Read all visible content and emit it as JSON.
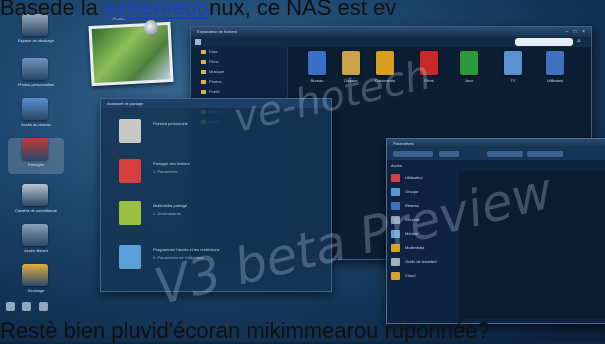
{
  "overlay": {
    "top_segments": [
      "Basede la ",
      "sysiemeoo",
      "nux, ce NAS est ev"
    ],
    "bottom_text": "Restè bien pluvid'écoran mikimmearou ruponnée?"
  },
  "watermark": {
    "line1": "ve-hotech",
    "line2": "V3 beta Preview"
  },
  "dock": {
    "items": [
      {
        "label": "Espace de stockage",
        "color": "#9aa8b8"
      },
      {
        "label": "Photos personnelles",
        "color": "#6f93c0"
      },
      {
        "label": "Accès au réseau",
        "color": "#5a8ed0"
      },
      {
        "label": "Partages",
        "color": "#c8383a"
      },
      {
        "label": "Caméra de surveillance",
        "color": "#b8c4d0"
      },
      {
        "label": "Accès distant",
        "color": "#8ca0b8"
      },
      {
        "label": "Stockage",
        "color": "#e0b040"
      }
    ],
    "tray": [
      "shield-icon",
      "globe-icon",
      "mail-icon"
    ]
  },
  "photo_widget": {
    "title": "Photos"
  },
  "file_window": {
    "title": "Explorateur de fichiers",
    "controls": "– □ ×",
    "search_placeholder": "",
    "tree_nodes": [
      "Data",
      "Films",
      "Musique",
      "Photos",
      "Public",
      "Backup",
      "Videos",
      "Divers"
    ],
    "files": [
      {
        "name": "Bureau",
        "color": "#3b6fc8"
      },
      {
        "name": "Dossier",
        "color": "#c9a24b"
      },
      {
        "name": "Documents",
        "color": "#d8a020"
      },
      {
        "name": "Films",
        "color": "#c82828"
      },
      {
        "name": "Jeux",
        "color": "#2a9a3a"
      },
      {
        "name": "TV",
        "color": "#5a8fd0"
      },
      {
        "name": "Utilitaires",
        "color": "#4070c0"
      }
    ]
  },
  "wizard_window": {
    "title": "Assistant de partage",
    "rows": [
      {
        "title": "Fichiers personnels",
        "subtitle": "",
        "color": "#c8c8c8"
      },
      {
        "title": "Partager des fichiers",
        "subtitle": "1. Paramètres",
        "color": "#d84040"
      },
      {
        "title": "Multimédia partagé",
        "subtitle": "2. Destinataires",
        "color": "#9ac040"
      },
      {
        "title": "Programmer l'accès et les restrictions",
        "subtitle": "3. Paramètres de l'utilisateur",
        "color": "#5aa0d8"
      }
    ]
  },
  "props_window": {
    "title": "Paramètres",
    "list_header": "Accès",
    "items": [
      {
        "label": "Utilisateur",
        "color": "#d04040"
      },
      {
        "label": "Groupe",
        "color": "#5a9ad8"
      },
      {
        "label": "Réseau",
        "color": "#4070c0"
      },
      {
        "label": "Sécurité",
        "color": "#8aa0b8"
      },
      {
        "label": "Médias",
        "color": "#6aa0d0"
      },
      {
        "label": "Multimédia",
        "color": "#d8a020"
      },
      {
        "label": "Outils de transfert",
        "color": "#a0b0c0"
      },
      {
        "label": "Cloud",
        "color": "#d8a030"
      }
    ]
  }
}
